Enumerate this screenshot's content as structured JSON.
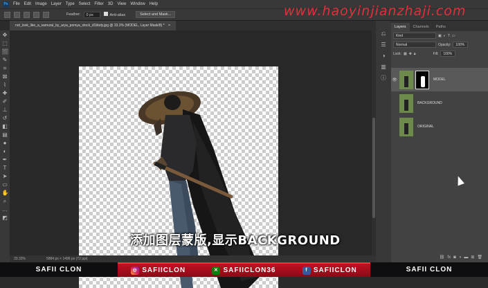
{
  "menubar": {
    "logo": "Ps",
    "items": [
      "File",
      "Edit",
      "Image",
      "Layer",
      "Type",
      "Select",
      "Filter",
      "3D",
      "View",
      "Window",
      "Help"
    ]
  },
  "options": {
    "feather_label": "Feather:",
    "feather_value": "0 px",
    "antialias_label": "Anti-alias",
    "select_mask_label": "Select and Mask..."
  },
  "watermark": "www.haoyinjianzhaji.com",
  "document_tab": {
    "title": "not_look_like_a_samurai_by_arya_pomya_stock_d1bbdy.jpg @ 33.3% (MODEL, Layer Mask/8) *",
    "close": "×"
  },
  "status": {
    "zoom": "33.33%",
    "doc_info": "5884 px × 1496 px (72 ppi)"
  },
  "panel": {
    "tabs": [
      "Layers",
      "Channels",
      "Paths"
    ],
    "kind_label": "Kind",
    "blend_mode": "Normal",
    "opacity_label": "Opacity:",
    "opacity_value": "100%",
    "lock_label": "Lock:",
    "fill_label": "Fill:",
    "fill_value": "100%",
    "layers": [
      {
        "name": "MODEL",
        "visible": true,
        "selected": true
      },
      {
        "name": "BACKGROUND",
        "visible": false,
        "selected": false
      },
      {
        "name": "ORIGINAL",
        "visible": false,
        "selected": false
      }
    ],
    "bottom_icons": [
      "link-icon",
      "fx-icon",
      "mask-icon",
      "adjustment-icon",
      "folder-icon",
      "new-layer-icon",
      "trash-icon"
    ]
  },
  "subtitle": "添加图层蒙版,显示BACKGROUND",
  "footer": {
    "name_left": "SAFII CLON",
    "name_right": "SAFII CLON",
    "instagram": "SAFIICLON",
    "xbox": "SAFIICLON36",
    "facebook": "SAFIICLON"
  },
  "colors": {
    "accent_red": "#c01020",
    "watermark": "#e0303b",
    "ui_dark": "#383838"
  }
}
